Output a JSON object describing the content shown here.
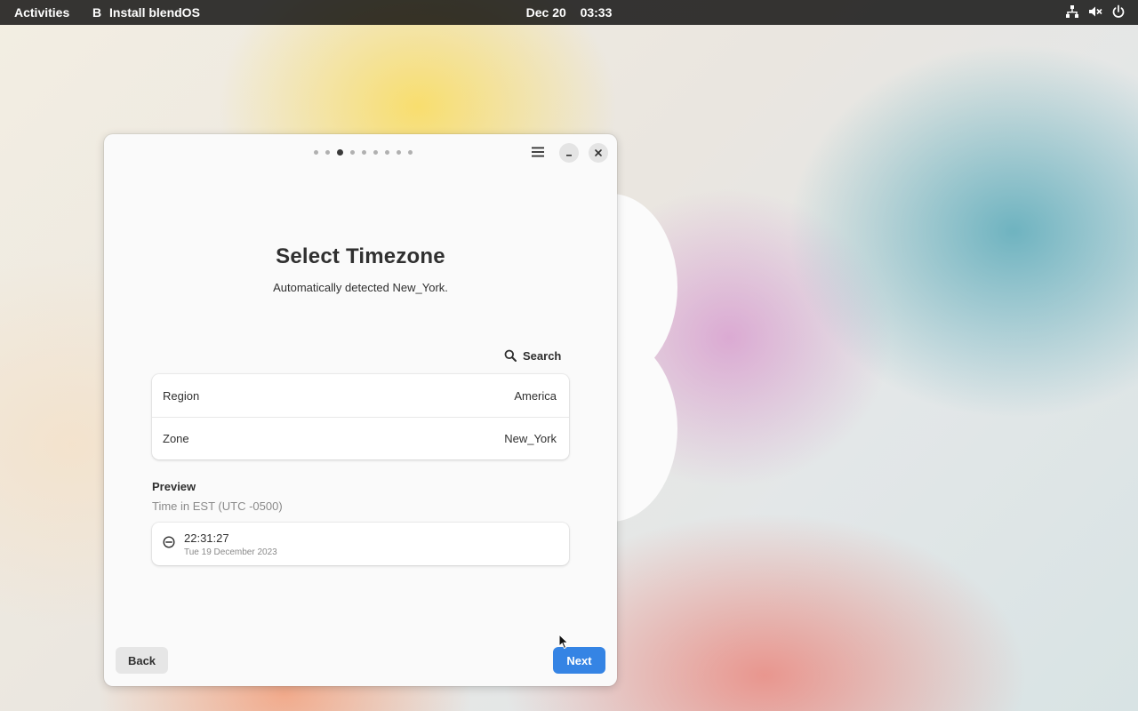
{
  "topbar": {
    "activities_label": "Activities",
    "app_icon_glyph": "B",
    "app_name": "Install blendOS",
    "date": "Dec 20",
    "time": "03:33",
    "status_icons": [
      "network-icon",
      "volume-muted-icon",
      "power-icon"
    ]
  },
  "window": {
    "step_total": 9,
    "step_current": 3,
    "title": "Select Timezone",
    "subtitle": "Automatically detected New_York.",
    "search_label": "Search",
    "timezone": {
      "region_label": "Region",
      "region_value": "America",
      "zone_label": "Zone",
      "zone_value": "New_York"
    },
    "preview": {
      "heading": "Preview",
      "subheading": "Time in EST (UTC -0500)",
      "time": "22:31:27",
      "date": "Tue 19 December 2023"
    },
    "back_label": "Back",
    "next_label": "Next"
  },
  "colors": {
    "accent": "#3584e4",
    "window_bg": "#fafafa",
    "topbar_bg": "#000000"
  }
}
